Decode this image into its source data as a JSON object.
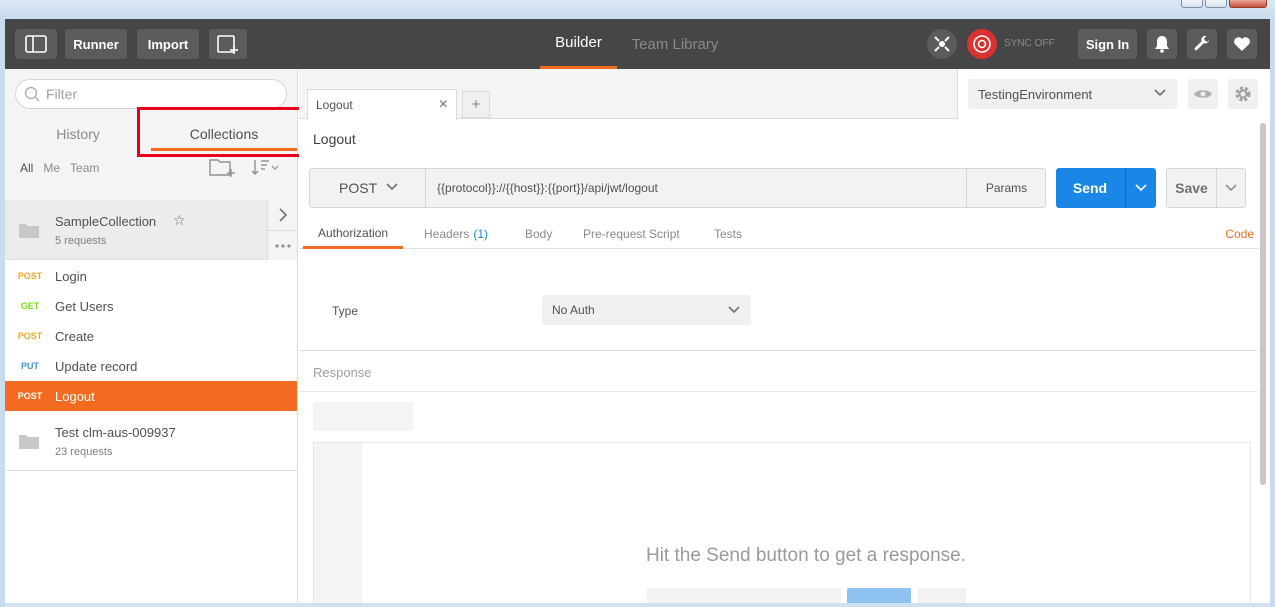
{
  "header": {
    "runner_label": "Runner",
    "import_label": "Import",
    "builder_tab": "Builder",
    "team_library_tab": "Team Library",
    "sync_label": "SYNC OFF",
    "sign_in_label": "Sign In"
  },
  "sidebar": {
    "filter_placeholder": "Filter",
    "history_tab": "History",
    "collections_tab": "Collections",
    "filters": [
      "All",
      "Me",
      "Team"
    ],
    "collections": [
      {
        "name": "SampleCollection",
        "count": "5 requests",
        "requests": [
          {
            "method": "POST",
            "name": "Login",
            "color": "#f5a623"
          },
          {
            "method": "GET",
            "name": "Get Users",
            "color": "#7ed321"
          },
          {
            "method": "POST",
            "name": "Create",
            "color": "#f5a623"
          },
          {
            "method": "PUT",
            "name": "Update record",
            "color": "#4a90e2"
          },
          {
            "method": "POST",
            "name": "Logout",
            "color": "#ffffff"
          }
        ]
      },
      {
        "name": "Test clm-aus-009937",
        "count": "23 requests"
      }
    ]
  },
  "main": {
    "tab_label": "Logout",
    "environment": "TestingEnvironment",
    "request_title": "Logout",
    "method": "POST",
    "url": "{{protocol}}://{{host}}:{{port}}/api/jwt/logout",
    "params_label": "Params",
    "send_label": "Send",
    "save_label": "Save",
    "subtabs": {
      "authorization": "Authorization",
      "headers": "Headers",
      "headers_count": "(1)",
      "body": "Body",
      "prerequest": "Pre-request Script",
      "tests": "Tests"
    },
    "code_label": "Code",
    "auth_type_label": "Type",
    "auth_type_value": "No Auth",
    "response_label": "Response",
    "response_message": "Hit the Send button to get a response."
  },
  "colors": {
    "accent": "#f26b21",
    "send": "#1a87e6",
    "header_bg": "#464646"
  }
}
